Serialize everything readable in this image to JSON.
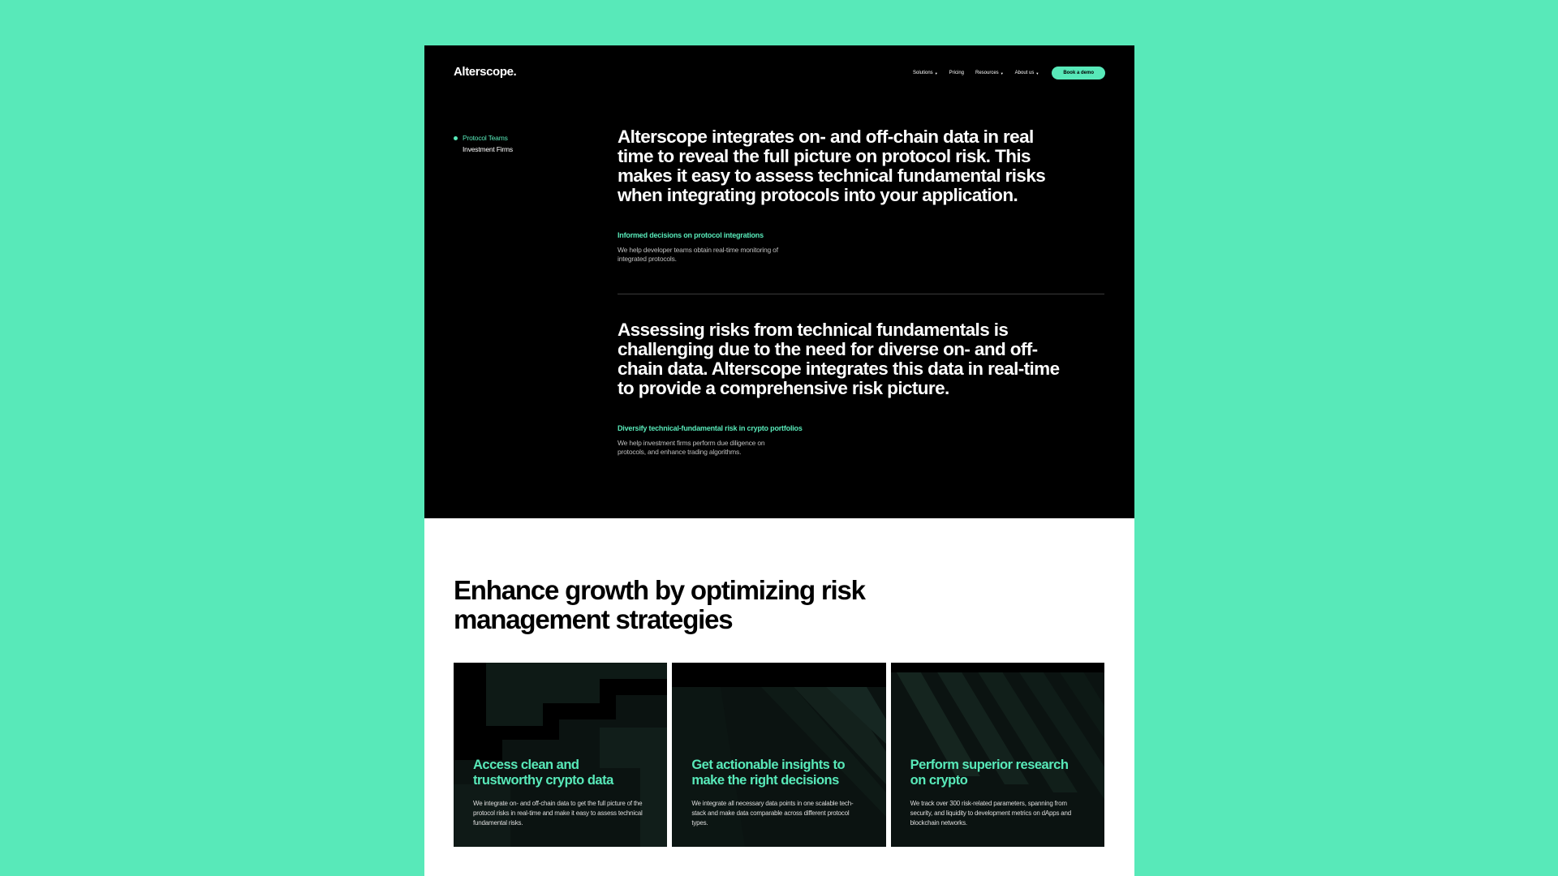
{
  "colors": {
    "accent": "#58e9b9",
    "dark_bg": "#000000",
    "page_bg": "#58e9b9"
  },
  "header": {
    "logo": "Alterscope.",
    "nav": [
      {
        "label": "Solutions",
        "has_dropdown": true
      },
      {
        "label": "Pricing",
        "has_dropdown": false
      },
      {
        "label": "Resources",
        "has_dropdown": true
      },
      {
        "label": "About us",
        "has_dropdown": true
      }
    ],
    "cta_label": "Book a demo"
  },
  "sidenav": {
    "items": [
      {
        "label": "Protocol Teams",
        "active": true
      },
      {
        "label": "Investment Firms",
        "active": false
      }
    ]
  },
  "sections": [
    {
      "headline": "Alterscope integrates on- and off-chain data in real time to reveal the full picture on protocol risk. This makes it easy to assess technical fundamental risks when integrating protocols into your application.",
      "subtitle": "Informed decisions on protocol integrations",
      "text": "We help developer teams obtain real-time monitoring of integrated protocols."
    },
    {
      "headline": "Assessing risks from technical fundamentals is challenging due to the need for diverse on- and off-chain data. Alterscope integrates this data in real-time to provide a comprehensive risk picture.",
      "subtitle": "Diversify technical-fundamental risk in crypto portfolios",
      "text": "We help investment firms perform due diligence on protocols, and enhance trading algorithms."
    }
  ],
  "growth": {
    "heading": "Enhance growth by optimizing risk management strategies",
    "cards": [
      {
        "title": "Access clean and trustworthy crypto data",
        "text": "We integrate on- and off-chain data to get the full picture of the protocol risks in real-time and make it easy to assess technical fundamental risks."
      },
      {
        "title": "Get actionable insights to make the right decisions",
        "text": "We integrate all necessary data points in one scalable tech-stack and make data comparable across different protocol types."
      },
      {
        "title": "Perform superior research on crypto",
        "text": "We track over 300 risk-related parameters, spanning from security, and liquidity to development metrics on dApps and blockchain networks."
      }
    ]
  }
}
